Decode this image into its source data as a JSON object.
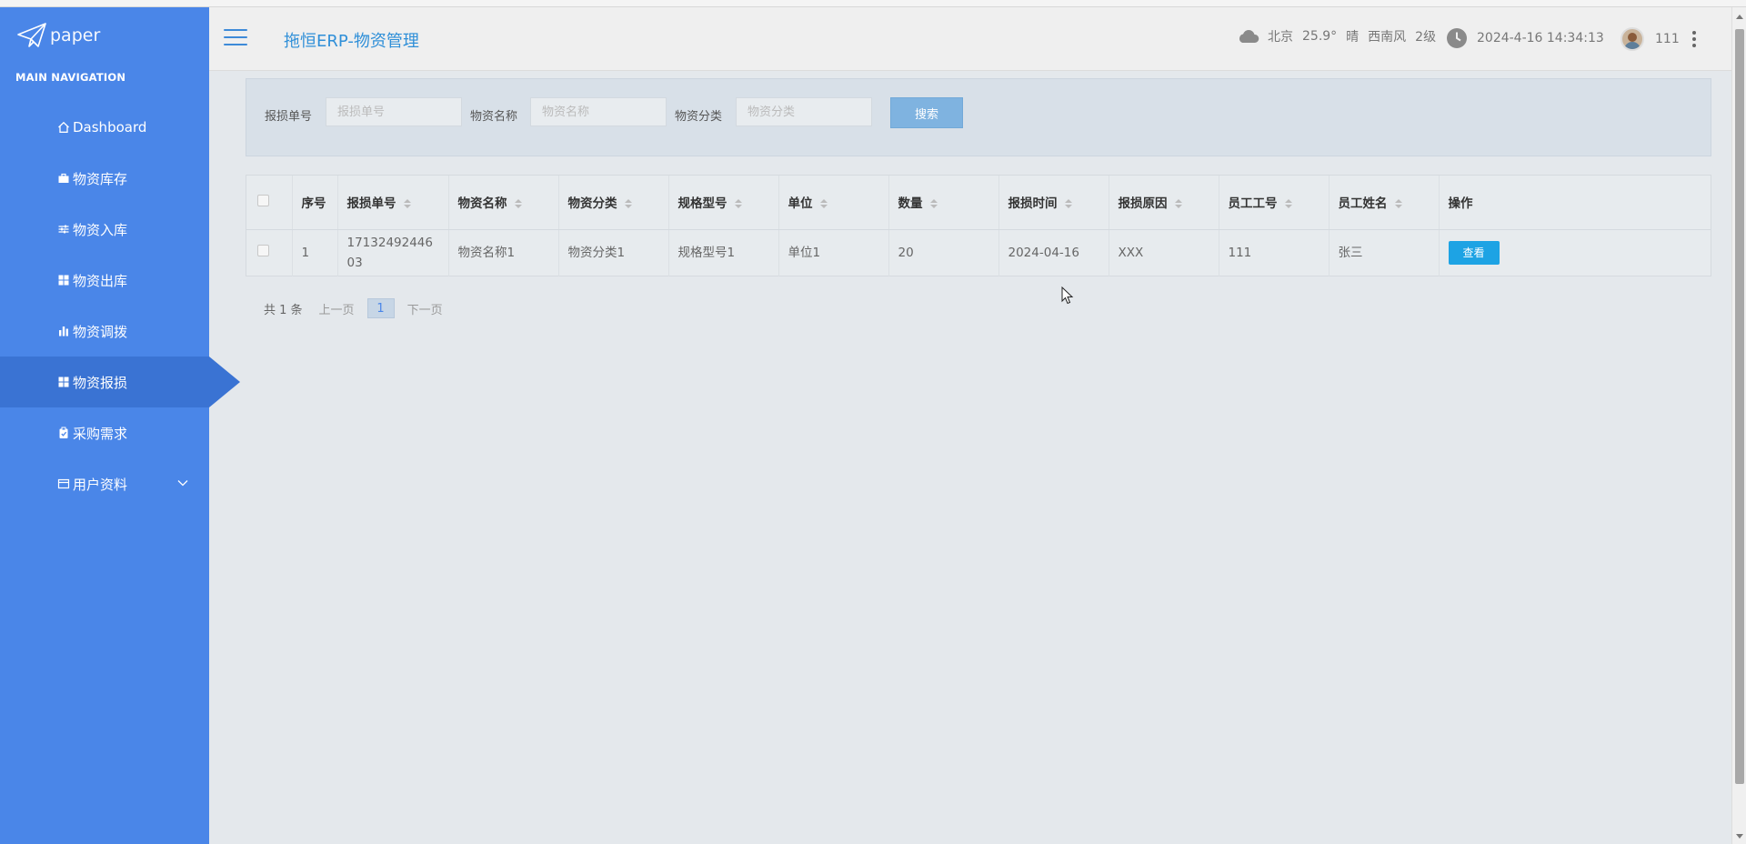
{
  "logo": {
    "text": "paper"
  },
  "sidebar": {
    "section_title": "MAIN NAVIGATION",
    "items": [
      {
        "label": "Dashboard",
        "icon": "home-icon"
      },
      {
        "label": "物资库存",
        "icon": "briefcase-icon"
      },
      {
        "label": "物资入库",
        "icon": "sliders-icon"
      },
      {
        "label": "物资出库",
        "icon": "grid-icon"
      },
      {
        "label": "物资调拨",
        "icon": "bar-chart-icon"
      },
      {
        "label": "物资报损",
        "icon": "grid-icon",
        "active": true
      },
      {
        "label": "采购需求",
        "icon": "clipboard-icon"
      },
      {
        "label": "用户资料",
        "icon": "card-icon",
        "has_submenu": true
      }
    ]
  },
  "header": {
    "title": "拖恒ERP-物资管理",
    "weather": {
      "city": "北京",
      "temp": "25.9°",
      "condition": "晴",
      "wind": "西南风",
      "level": "2级"
    },
    "datetime": "2024-4-16 14:34:13",
    "username": "111"
  },
  "search": {
    "fields": [
      {
        "label": "报损单号",
        "placeholder": "报损单号"
      },
      {
        "label": "物资名称",
        "placeholder": "物资名称"
      },
      {
        "label": "物资分类",
        "placeholder": "物资分类"
      }
    ],
    "button": "搜索"
  },
  "table": {
    "columns": [
      "序号",
      "报损单号",
      "物资名称",
      "物资分类",
      "规格型号",
      "单位",
      "数量",
      "报损时间",
      "报损原因",
      "员工工号",
      "员工姓名",
      "操作"
    ],
    "rows": [
      {
        "index": "1",
        "no": "1713249244603",
        "name": "物资名称1",
        "category": "物资分类1",
        "spec": "规格型号1",
        "unit": "单位1",
        "qty": "20",
        "date": "2024-04-16",
        "reason": "XXX",
        "emp_no": "111",
        "emp_name": "张三",
        "action": "查看"
      }
    ]
  },
  "pager": {
    "total": "共 1 条",
    "prev": "上一页",
    "current": "1",
    "next": "下一页"
  },
  "colors": {
    "sidebar": "#4a86e8",
    "sidebar_active": "#3a73d3",
    "accent": "#1da3e4",
    "title": "#2f8fd8"
  }
}
